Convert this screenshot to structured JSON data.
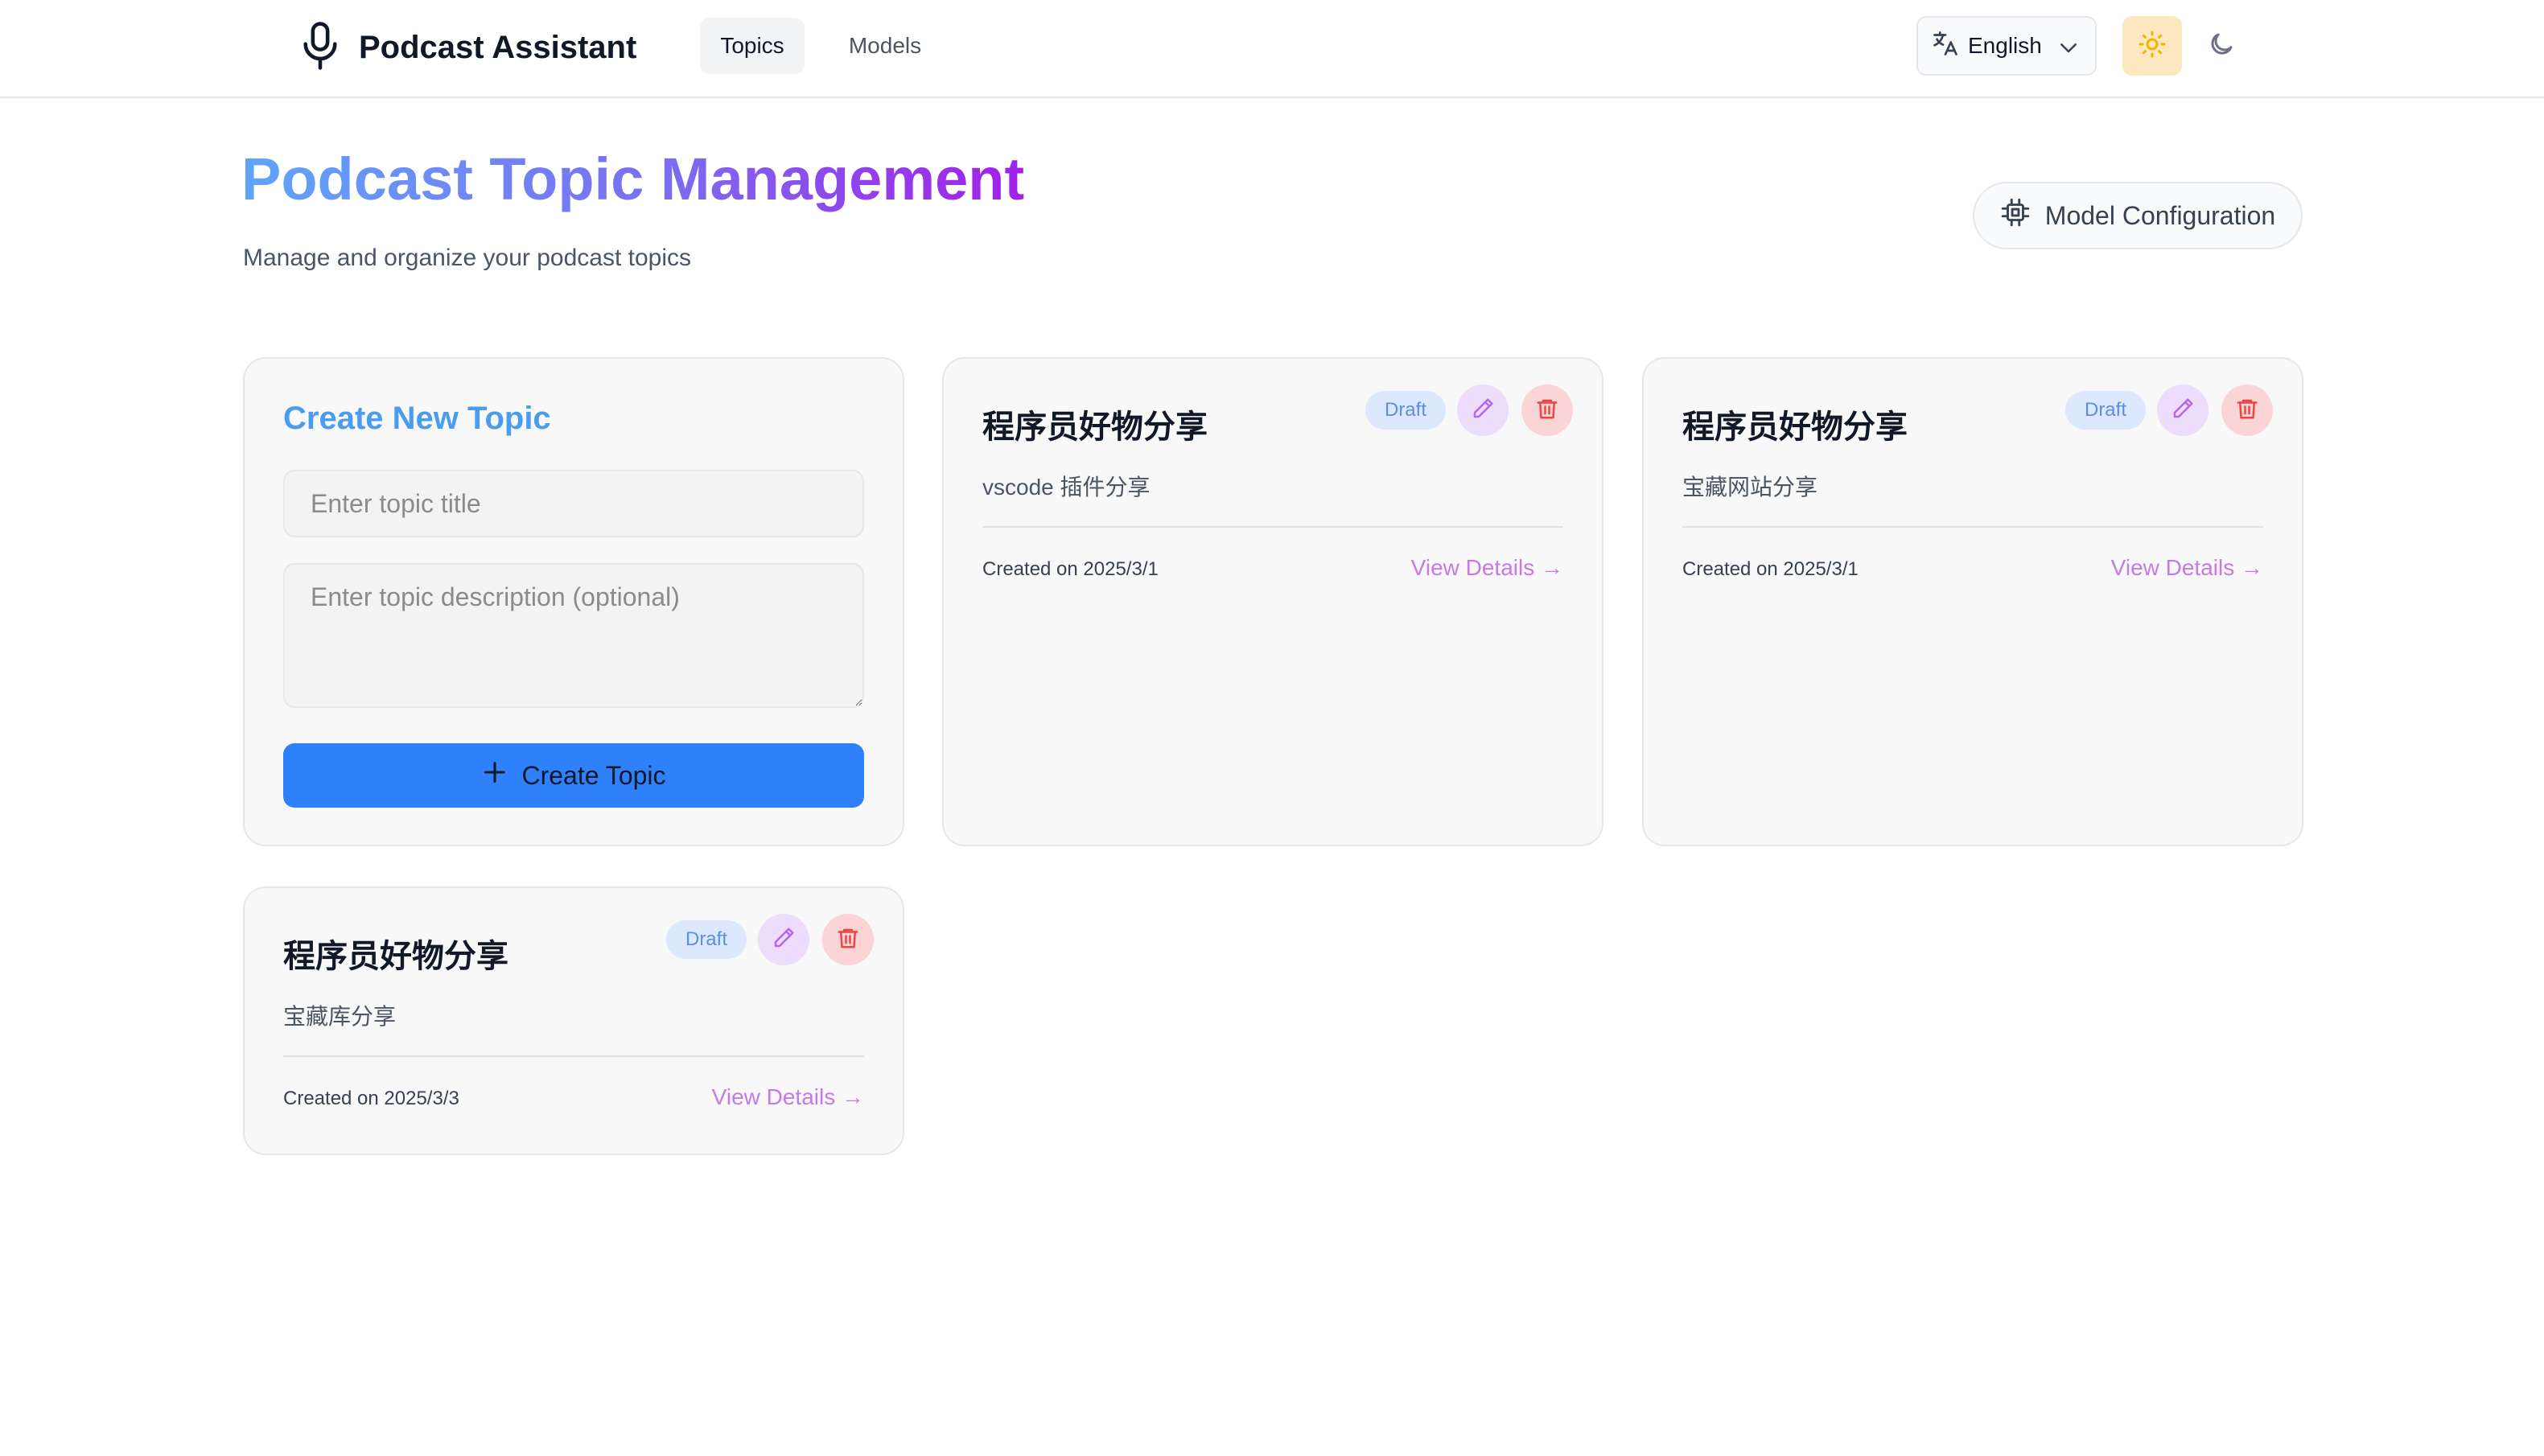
{
  "header": {
    "app_title": "Podcast Assistant",
    "nav": [
      {
        "label": "Topics",
        "active": true
      },
      {
        "label": "Models",
        "active": false
      }
    ],
    "language": {
      "selected": "English"
    },
    "icons": {
      "logo": "microphone-icon",
      "language": "translate-icon",
      "chevron": "chevron-down-icon",
      "light_theme": "sun-icon",
      "dark_theme": "moon-icon"
    }
  },
  "page": {
    "title": "Podcast Topic Management",
    "subtitle": "Manage and organize your podcast topics",
    "model_config_label": "Model Configuration",
    "model_config_icon": "cpu-chip-icon"
  },
  "create_form": {
    "heading": "Create New Topic",
    "title_placeholder": "Enter topic title",
    "title_value": "",
    "description_placeholder": "Enter topic description (optional)",
    "description_value": "",
    "submit_label": "Create Topic",
    "submit_icon": "plus-icon"
  },
  "topics": [
    {
      "title": "程序员好物分享",
      "description": "vscode 插件分享",
      "status": "Draft",
      "created": "Created on 2025/3/1",
      "view_label": "View Details →"
    },
    {
      "title": "程序员好物分享",
      "description": "宝藏网站分享",
      "status": "Draft",
      "created": "Created on 2025/3/1",
      "view_label": "View Details →"
    },
    {
      "title": "程序员好物分享",
      "description": "宝藏库分享",
      "status": "Draft",
      "created": "Created on 2025/3/3",
      "view_label": "View Details →"
    }
  ],
  "colors": {
    "primary_button": "#2f80fb",
    "title_gradient_start": "#60a5fa",
    "title_gradient_end": "#a21fe8",
    "create_heading": "#4a9cf0",
    "badge_bg": "#dbe8fd",
    "edit_bg": "#eddcfb",
    "delete_bg": "#fbd5d5",
    "view_link": "#c57ae6",
    "light_theme_active_bg": "#fde7c0"
  }
}
